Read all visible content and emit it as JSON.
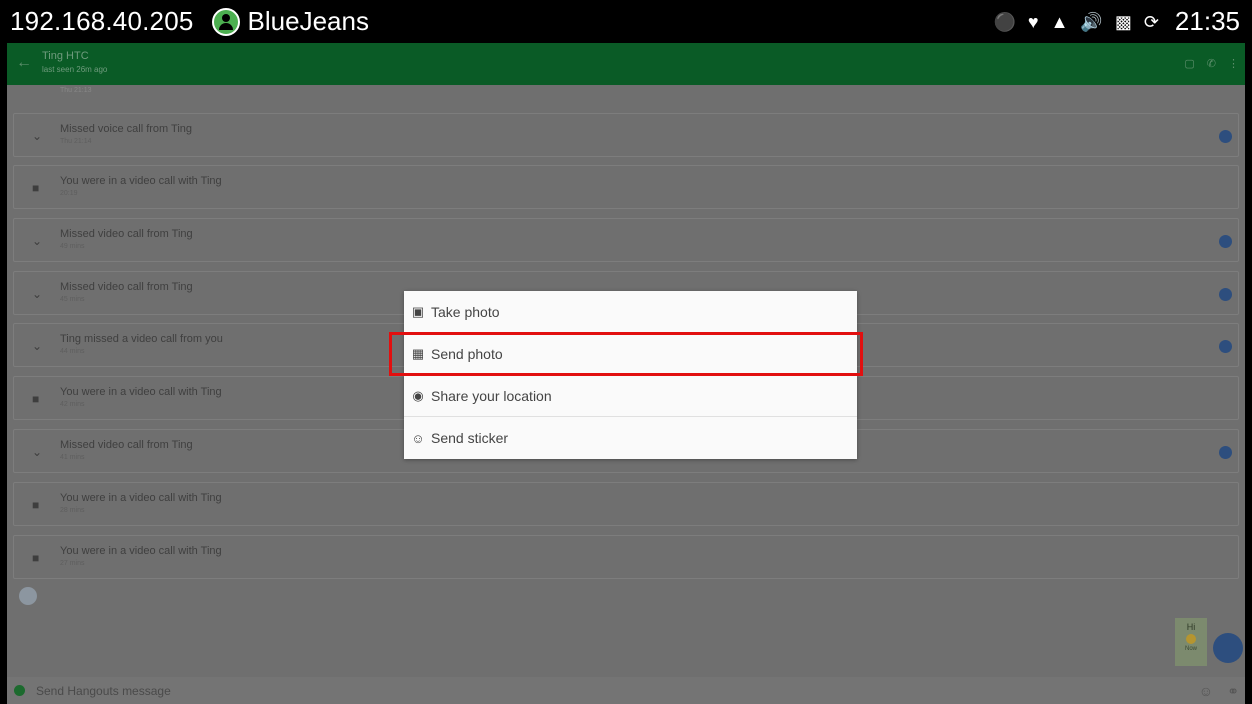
{
  "status_bar": {
    "ip": "192.168.40.205",
    "app_name": "BlueJeans",
    "time": "21:35",
    "icons": [
      "usb-icon",
      "heart-icon",
      "warning-icon",
      "volume-icon",
      "sim-icon",
      "sync-icon"
    ]
  },
  "conversation": {
    "contact_name": "Ting HTC",
    "last_seen": "last seen 26m ago",
    "top_partial_time": "Thu 21:13"
  },
  "rows": [
    {
      "icon": "missed-call-icon",
      "title": "Missed voice call from Ting",
      "time": "Thu 21:14",
      "avatar": true
    },
    {
      "icon": "video-icon",
      "title": "You were in a video call with Ting",
      "time": "20:19",
      "avatar": false
    },
    {
      "icon": "missed-call-icon",
      "title": "Missed video call from Ting",
      "time": "49 mins",
      "avatar": true
    },
    {
      "icon": "missed-call-icon",
      "title": "Missed video call from Ting",
      "time": "45 mins",
      "avatar": true
    },
    {
      "icon": "missed-call-icon",
      "title": "Ting missed a video call from you",
      "time": "44 mins",
      "avatar": true
    },
    {
      "icon": "video-icon",
      "title": "You were in a video call with Ting",
      "time": "42 mins",
      "avatar": false
    },
    {
      "icon": "missed-call-icon",
      "title": "Missed video call from Ting",
      "time": "41 mins",
      "avatar": true
    },
    {
      "icon": "video-icon",
      "title": "You were in a video call with Ting",
      "time": "28 mins",
      "avatar": false
    },
    {
      "icon": "video-icon",
      "title": "You were in a video call with Ting",
      "time": "27 mins",
      "avatar": false
    }
  ],
  "message": {
    "text": "Hi",
    "time": "Now"
  },
  "composer": {
    "placeholder": "Send Hangouts message"
  },
  "menu": {
    "items": [
      {
        "icon": "camera-icon",
        "label": "Take photo"
      },
      {
        "icon": "image-icon",
        "label": "Send photo"
      },
      {
        "icon": "location-icon",
        "label": "Share your location"
      },
      {
        "icon": "sticker-icon",
        "label": "Send sticker"
      }
    ],
    "highlighted_index": 1,
    "highlight_color": "#e20f0f"
  },
  "colors": {
    "appbar": "#0a5b26",
    "status_bar": "#000000"
  }
}
